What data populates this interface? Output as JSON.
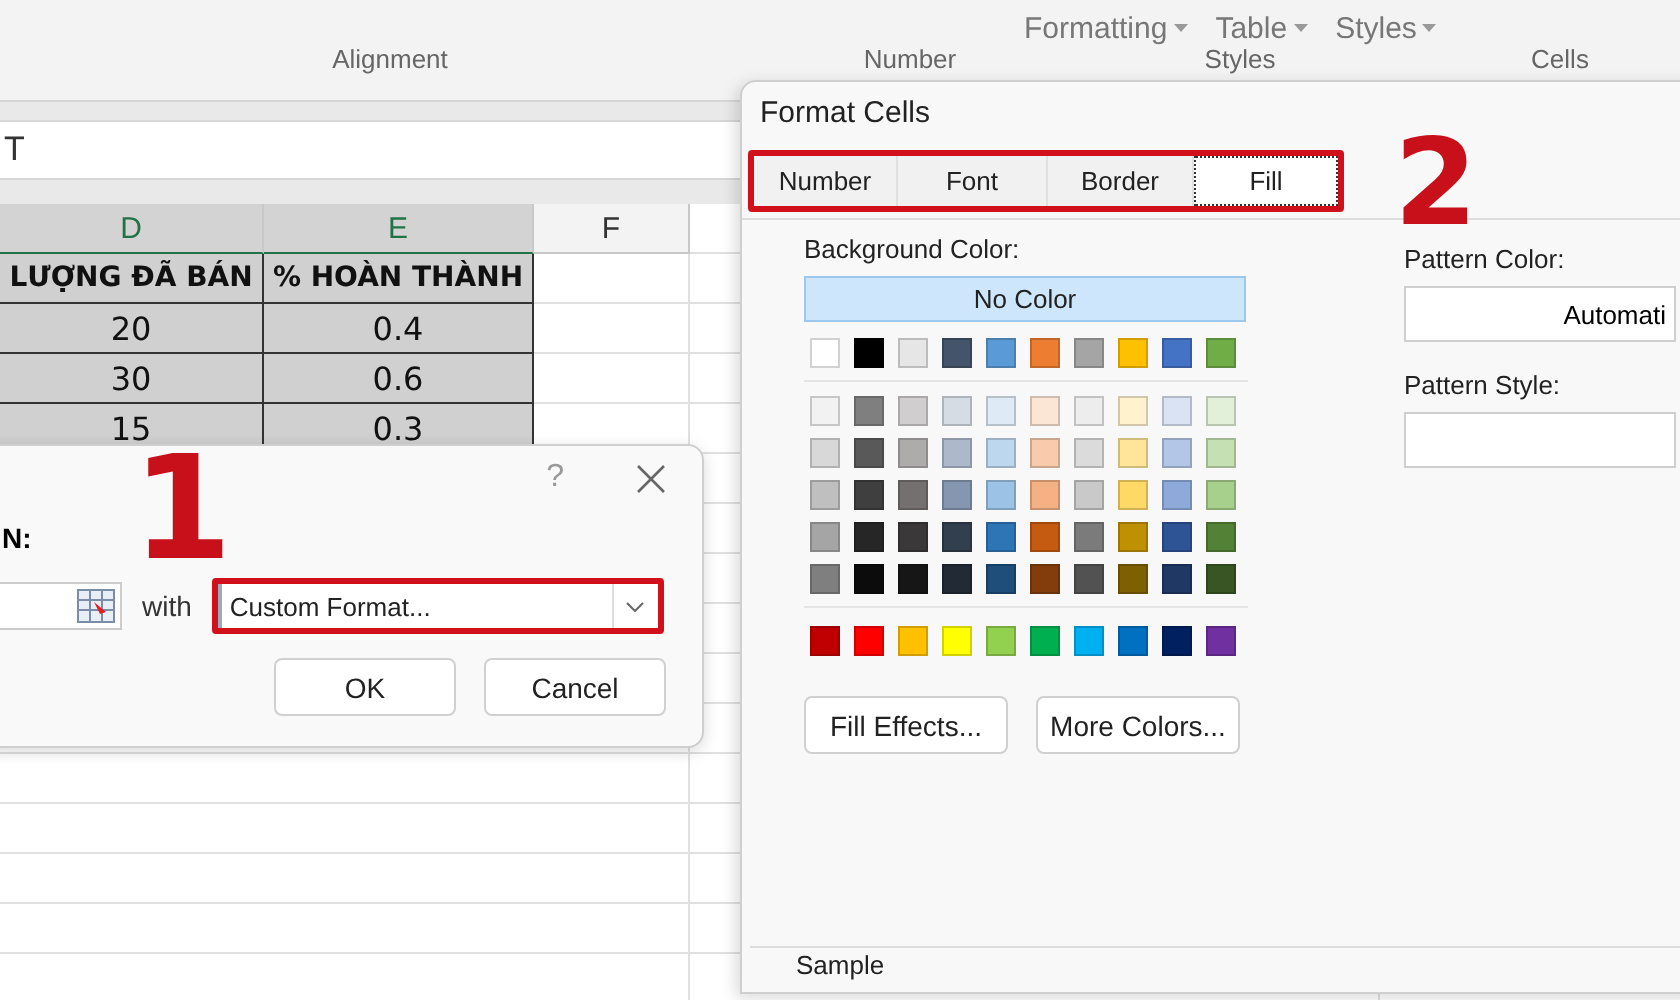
{
  "ribbon": {
    "style_buttons": [
      "Formatting",
      "Table",
      "Styles"
    ],
    "groups": [
      "Alignment",
      "Number",
      "Styles",
      "Cells"
    ]
  },
  "formula_bar": {
    "value": "T"
  },
  "sheet": {
    "columns": [
      {
        "label": "D",
        "selected": true
      },
      {
        "label": "E",
        "selected": true
      },
      {
        "label": "F",
        "selected": false
      }
    ],
    "rows": [
      {
        "kind": "header",
        "cells": [
          "LƯỢNG ĐÃ BÁN",
          "% HOÀN THÀNH"
        ]
      },
      {
        "kind": "data",
        "cells": [
          "20",
          "0.4"
        ]
      },
      {
        "kind": "data",
        "cells": [
          "30",
          "0.6"
        ]
      },
      {
        "kind": "data",
        "cells": [
          "15",
          "0.3"
        ]
      }
    ]
  },
  "rule_dialog": {
    "help": "?",
    "label": "N:",
    "with_label": "with",
    "format_select": {
      "value": "Custom Format..."
    },
    "buttons": [
      "OK",
      "Cancel"
    ],
    "annotation": "1"
  },
  "format_cells": {
    "title": "Format Cells",
    "annotation": "2",
    "tabs": [
      {
        "label": "Number",
        "selected": false
      },
      {
        "label": "Font",
        "selected": false
      },
      {
        "label": "Border",
        "selected": false
      },
      {
        "label": "Fill",
        "selected": true
      }
    ],
    "background_color_label": "Background Color:",
    "no_color": "No Color",
    "theme_row": [
      {
        "color": "#ffffff"
      },
      {
        "color": "#000000"
      },
      {
        "color": "#e7e6e6"
      },
      {
        "color": "#44546a"
      },
      {
        "color": "#5b9bd5"
      },
      {
        "color": "#ed7d31"
      },
      {
        "color": "#a5a5a5"
      },
      {
        "color": "#ffc000"
      },
      {
        "color": "#4472c4"
      },
      {
        "color": "#70ad47"
      }
    ],
    "tint_rows": [
      [
        {
          "color": "#f2f2f2"
        },
        {
          "color": "#7f7f7f"
        },
        {
          "color": "#d0cece"
        },
        {
          "color": "#d6dce4"
        },
        {
          "color": "#deebf6"
        },
        {
          "color": "#fbe5d5"
        },
        {
          "color": "#ededed"
        },
        {
          "color": "#fff2cc"
        },
        {
          "color": "#dae3f3"
        },
        {
          "color": "#e2efd9"
        }
      ],
      [
        {
          "color": "#d8d8d8"
        },
        {
          "color": "#595959"
        },
        {
          "color": "#aeabab"
        },
        {
          "color": "#adb9ca"
        },
        {
          "color": "#bdd7ee"
        },
        {
          "color": "#f7cbac"
        },
        {
          "color": "#dbdbdb"
        },
        {
          "color": "#fee599"
        },
        {
          "color": "#b4c6e7"
        },
        {
          "color": "#c5e0b3"
        }
      ],
      [
        {
          "color": "#bfbfbf"
        },
        {
          "color": "#3f3f3f"
        },
        {
          "color": "#757070"
        },
        {
          "color": "#8496b0"
        },
        {
          "color": "#9cc3e5"
        },
        {
          "color": "#f4b183"
        },
        {
          "color": "#c9c9c9"
        },
        {
          "color": "#ffd965"
        },
        {
          "color": "#8eaadb"
        },
        {
          "color": "#a8d08d"
        }
      ],
      [
        {
          "color": "#a5a5a5"
        },
        {
          "color": "#262626"
        },
        {
          "color": "#3a3838"
        },
        {
          "color": "#323f4f"
        },
        {
          "color": "#2e75b5"
        },
        {
          "color": "#c55a11"
        },
        {
          "color": "#7b7b7b"
        },
        {
          "color": "#bf9000"
        },
        {
          "color": "#2f5496"
        },
        {
          "color": "#538135"
        }
      ],
      [
        {
          "color": "#7f7f7f"
        },
        {
          "color": "#0c0c0c"
        },
        {
          "color": "#171616"
        },
        {
          "color": "#222a35"
        },
        {
          "color": "#1e4e79"
        },
        {
          "color": "#833c0b"
        },
        {
          "color": "#525252"
        },
        {
          "color": "#7f6000"
        },
        {
          "color": "#1f3864"
        },
        {
          "color": "#375623"
        }
      ]
    ],
    "standard_row": [
      {
        "color": "#c00000"
      },
      {
        "color": "#ff0000"
      },
      {
        "color": "#ffc000"
      },
      {
        "color": "#ffff00"
      },
      {
        "color": "#92d050"
      },
      {
        "color": "#00b050"
      },
      {
        "color": "#00b0f0"
      },
      {
        "color": "#0070c0"
      },
      {
        "color": "#002060"
      },
      {
        "color": "#7030a0"
      }
    ],
    "buttons": [
      "Fill Effects...",
      "More Colors..."
    ],
    "pattern_color": {
      "label": "Pattern Color:",
      "value": "Automati"
    },
    "pattern_style": {
      "label": "Pattern Style:"
    },
    "sample_label": "Sample"
  }
}
